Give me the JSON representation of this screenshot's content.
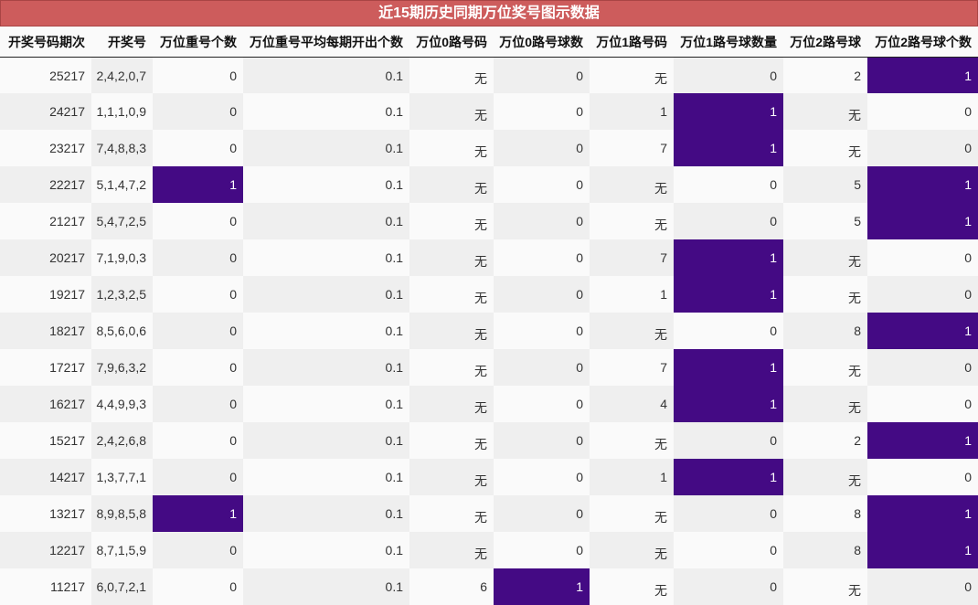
{
  "title": "近15期历史同期万位奖号图示数据",
  "columns": [
    "开奖号码期次",
    "开奖号",
    "万位重号个数",
    "万位重号平均每期开出个数",
    "万位0路号码",
    "万位0路号球数",
    "万位1路号码",
    "万位1路号球数量",
    "万位2路号球",
    "万位2路号球个数"
  ],
  "colors": {
    "title_bg": "#cd5c5c",
    "highlight": "#440a84",
    "shade": "#efefef"
  },
  "rows": [
    {
      "cells": [
        "25217",
        "2,4,2,0,7",
        "0",
        "0.1",
        "无",
        "0",
        "无",
        "0",
        "2",
        "1"
      ],
      "highlight": [
        9
      ]
    },
    {
      "cells": [
        "24217",
        "1,1,1,0,9",
        "0",
        "0.1",
        "无",
        "0",
        "1",
        "1",
        "无",
        "0"
      ],
      "highlight": [
        7
      ]
    },
    {
      "cells": [
        "23217",
        "7,4,8,8,3",
        "0",
        "0.1",
        "无",
        "0",
        "7",
        "1",
        "无",
        "0"
      ],
      "highlight": [
        7
      ]
    },
    {
      "cells": [
        "22217",
        "5,1,4,7,2",
        "1",
        "0.1",
        "无",
        "0",
        "无",
        "0",
        "5",
        "1"
      ],
      "highlight": [
        2,
        9
      ]
    },
    {
      "cells": [
        "21217",
        "5,4,7,2,5",
        "0",
        "0.1",
        "无",
        "0",
        "无",
        "0",
        "5",
        "1"
      ],
      "highlight": [
        9
      ]
    },
    {
      "cells": [
        "20217",
        "7,1,9,0,3",
        "0",
        "0.1",
        "无",
        "0",
        "7",
        "1",
        "无",
        "0"
      ],
      "highlight": [
        7
      ]
    },
    {
      "cells": [
        "19217",
        "1,2,3,2,5",
        "0",
        "0.1",
        "无",
        "0",
        "1",
        "1",
        "无",
        "0"
      ],
      "highlight": [
        7
      ]
    },
    {
      "cells": [
        "18217",
        "8,5,6,0,6",
        "0",
        "0.1",
        "无",
        "0",
        "无",
        "0",
        "8",
        "1"
      ],
      "highlight": [
        9
      ]
    },
    {
      "cells": [
        "17217",
        "7,9,6,3,2",
        "0",
        "0.1",
        "无",
        "0",
        "7",
        "1",
        "无",
        "0"
      ],
      "highlight": [
        7
      ]
    },
    {
      "cells": [
        "16217",
        "4,4,9,9,3",
        "0",
        "0.1",
        "无",
        "0",
        "4",
        "1",
        "无",
        "0"
      ],
      "highlight": [
        7
      ]
    },
    {
      "cells": [
        "15217",
        "2,4,2,6,8",
        "0",
        "0.1",
        "无",
        "0",
        "无",
        "0",
        "2",
        "1"
      ],
      "highlight": [
        9
      ]
    },
    {
      "cells": [
        "14217",
        "1,3,7,7,1",
        "0",
        "0.1",
        "无",
        "0",
        "1",
        "1",
        "无",
        "0"
      ],
      "highlight": [
        7
      ]
    },
    {
      "cells": [
        "13217",
        "8,9,8,5,8",
        "1",
        "0.1",
        "无",
        "0",
        "无",
        "0",
        "8",
        "1"
      ],
      "highlight": [
        2,
        9
      ]
    },
    {
      "cells": [
        "12217",
        "8,7,1,5,9",
        "0",
        "0.1",
        "无",
        "0",
        "无",
        "0",
        "8",
        "1"
      ],
      "highlight": [
        9
      ]
    },
    {
      "cells": [
        "11217",
        "6,0,7,2,1",
        "0",
        "0.1",
        "6",
        "1",
        "无",
        "0",
        "无",
        "0"
      ],
      "highlight": [
        5
      ]
    }
  ]
}
